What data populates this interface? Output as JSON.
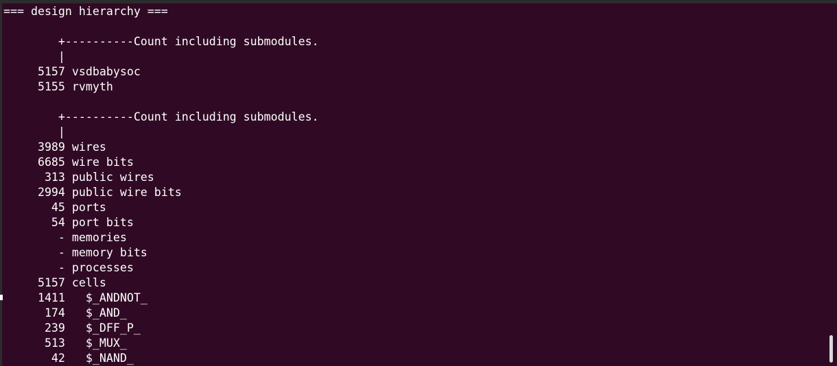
{
  "terminal": {
    "lines": [
      "=== design hierarchy ===",
      "",
      "        +----------Count including submodules.",
      "        |",
      "     5157 vsdbabysoc",
      "     5155 rvmyth",
      "",
      "        +----------Count including submodules.",
      "        |",
      "     3989 wires",
      "     6685 wire bits",
      "      313 public wires",
      "     2994 public wire bits",
      "       45 ports",
      "       54 port bits",
      "        - memories",
      "        - memory bits",
      "        - processes",
      "     5157 cells",
      "     1411   $_ANDNOT_",
      "      174   $_AND_",
      "      239   $_DFF_P_",
      "      513   $_MUX_",
      "       42   $_NAND_"
    ]
  }
}
